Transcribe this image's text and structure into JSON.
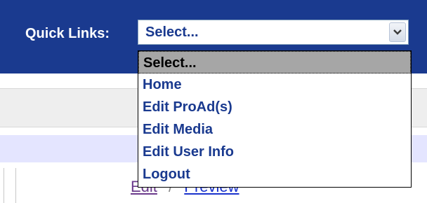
{
  "quick_links": {
    "label": "Quick Links:",
    "selected_value": "Select...",
    "options": [
      "Select...",
      "Home",
      "Edit ProAd(s)",
      "Edit Media",
      "Edit User Info",
      "Logout"
    ]
  },
  "page_links": {
    "edit": "Edit",
    "separator": "/",
    "preview": "Preview"
  },
  "colors": {
    "header": "#1a3a8f",
    "row_gray": "#eeeeee",
    "row_lavender": "#e4e5ff",
    "highlight": "#a6a6a6"
  },
  "icons": {
    "dropdown_arrow": "chevron-down-icon"
  }
}
